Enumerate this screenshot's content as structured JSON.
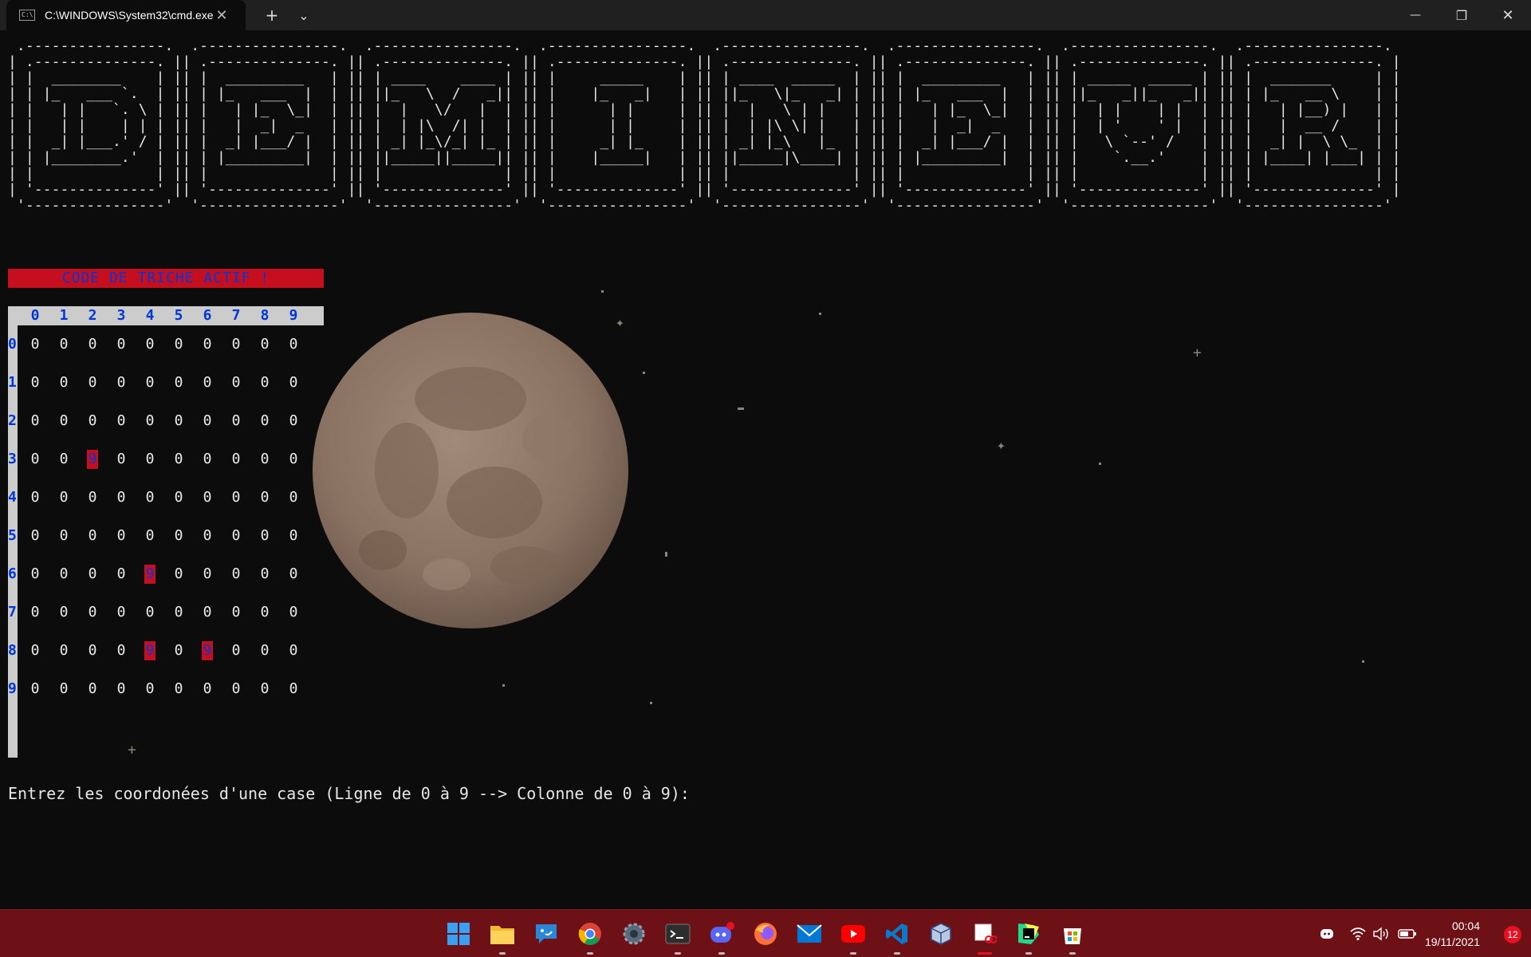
{
  "window": {
    "tab_title": "C:\\WINDOWS\\System32\\cmd.exe",
    "tab_icon": "C:\\",
    "close_symbol": "✕",
    "new_tab_symbol": "+",
    "dropdown_symbol": "⌄",
    "minimize_symbol": "—",
    "restore_symbol": "❐",
    "window_close_symbol": "✕"
  },
  "banner": {
    "lines": [
      " .----------------.  .----------------.  .----------------.  .----------------.  .----------------.  .----------------.  .----------------.  .----------------. ",
      "| .--------------. || .--------------. || .--------------. || .--------------. || .--------------. || .--------------. || .--------------. || .--------------. |",
      "| |  ________    | || |  _________   | || | ____    ____ | || |     _____    | || | ____  _____  | || |  _________   | || | _____  _____ | || |  _______     | |",
      "| | |_   ___ `.  | || | |_   ___  |  | || ||_   \\  /   _|| || |    |_   _|   | || ||_   \\|_   _| | || | |_   ___  |  | || ||_   _||_   _|| || | |_   __ \\    | |",
      "| |   | |   `. \\ | || |   | |_  \\_|  | || |  |   \\/   |  | || |      | |     | || |  |   \\ | |   | || |   | |_  \\_|  | || |  | |    | |  | || |   | |__) |   | |",
      "| |   | |    | | | || |   |  _|  _   | || |  | |\\  /| |  | || |      | |     | || |  | |\\ \\| |   | || |   |  _|  _   | || |  | '    ' |  | || |   |  __ /    | |",
      "| |  _| |___.' / | || |  _| |___/ |  | || | _| |_\\/_| |_ | || |     _| |_    | || | _| |_\\   |_  | || |  _| |___/ |  | || |   \\ `--' /   | || |  _| |  \\ \\_  | |",
      "| | |________.'  | || | |_________|  | || ||_____||_____|| || |    |_____|   | || ||_____|\\____| | || | |_________|  | || |    `.__.'    | || | |____| |___| | |",
      "| |              | || |              | || |              | || |              | || |              | || |              | || |              | || |              | |",
      "| '--------------' || '--------------' || '--------------' || '--------------' || '--------------' || '--------------' || '--------------' || '--------------' |",
      " '----------------'  '----------------'  '----------------'  '----------------'  '----------------'  '----------------'  '----------------'  '----------------' "
    ]
  },
  "cheat_banner": "CODE DE TRICHE ACTIF !",
  "board": {
    "column_labels": [
      "0",
      "1",
      "2",
      "3",
      "4",
      "5",
      "6",
      "7",
      "8",
      "9"
    ],
    "row_labels": [
      "0",
      "1",
      "2",
      "3",
      "4",
      "5",
      "6",
      "7",
      "8",
      "9"
    ],
    "default_cell": "0",
    "mine_symbol": "9",
    "mines": [
      [
        3,
        2
      ],
      [
        6,
        4
      ],
      [
        8,
        4
      ],
      [
        8,
        6
      ]
    ]
  },
  "prompt": "Entrez les coordonées d'une case (Ligne de 0 à 9 --> Colonne de 0 à 9):",
  "colors": {
    "terminal_bg": "#0c0c0c",
    "cheat_bg": "#c50f1f",
    "label_blue": "#0037da",
    "taskbar_bg": "#6e1116"
  },
  "taskbar": {
    "apps": [
      {
        "name": "start-icon"
      },
      {
        "name": "file-explorer-icon"
      },
      {
        "name": "feedback-hub-icon"
      },
      {
        "name": "chrome-icon"
      },
      {
        "name": "settings-icon"
      },
      {
        "name": "terminal-icon"
      },
      {
        "name": "discord-icon"
      },
      {
        "name": "firefox-icon"
      },
      {
        "name": "mail-icon"
      },
      {
        "name": "youtube-icon"
      },
      {
        "name": "vscode-icon"
      },
      {
        "name": "virtualbox-icon"
      },
      {
        "name": "snipping-tool-icon"
      },
      {
        "name": "pycharm-icon"
      },
      {
        "name": "store-icon"
      }
    ],
    "tray": [
      "discord-tray-icon",
      "wifi-icon",
      "volume-icon",
      "battery-icon"
    ],
    "time": "00:04",
    "date": "19/11/2021",
    "notification_count": "12"
  }
}
